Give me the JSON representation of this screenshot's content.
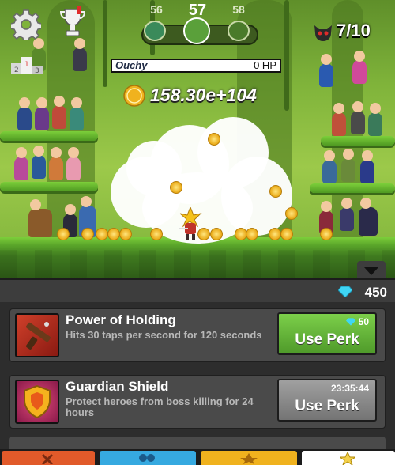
{
  "hud": {
    "stages": {
      "previous": "56",
      "current": "57",
      "next": "58"
    },
    "kills_text": "7/10",
    "boss_name": "Ouchy",
    "boss_hp": "0 HP",
    "gold": "158.30e+104"
  },
  "panel": {
    "diamonds": "450",
    "perks": [
      {
        "title": "Power of Holding",
        "description": "Hits 30 taps per second for 120 seconds",
        "button_label": "Use Perk",
        "cost": "50",
        "icon": "gun-icon"
      },
      {
        "title": "Guardian Shield",
        "description": "Protect heroes from boss killing for 24 hours",
        "button_label": "Use Perk",
        "cost": "23:35:44",
        "icon": "shield-icon"
      }
    ]
  },
  "tabs": [
    {
      "icon": "sword-icon",
      "color": "#e15a2a"
    },
    {
      "icon": "heroes-icon",
      "color": "#36a9e0"
    },
    {
      "icon": "artifacts-icon",
      "color": "#f0b21e"
    },
    {
      "icon": "shop-icon",
      "color": "#f3d04a"
    }
  ],
  "colors": {
    "use_perk_enabled": "#63b23a",
    "use_perk_disabled": "#8a8a8a",
    "diamond": "#3fd6f5",
    "gold": "#f0b21e"
  }
}
